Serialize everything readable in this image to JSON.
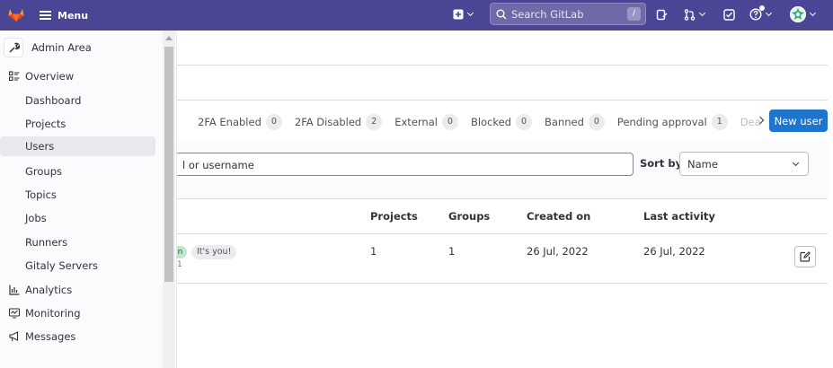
{
  "topbar": {
    "menu_label": "Menu",
    "search_placeholder": "Search GitLab",
    "search_shortcut": "/",
    "colors": {
      "bg": "#4a4594",
      "logo": "#e24329"
    },
    "icons": [
      "gitlab-logo",
      "plus-square-icon",
      "search-icon",
      "issues-icon",
      "merge-request-icon",
      "todo-check-icon",
      "help-icon",
      "avatar"
    ]
  },
  "sidebar": {
    "header": "Admin Area",
    "items": [
      {
        "label": "Overview",
        "level": "top",
        "icon": "overview-icon"
      },
      {
        "label": "Dashboard",
        "level": "sub"
      },
      {
        "label": "Projects",
        "level": "sub"
      },
      {
        "label": "Users",
        "level": "sub",
        "active": true
      },
      {
        "label": "Groups",
        "level": "sub"
      },
      {
        "label": "Topics",
        "level": "sub"
      },
      {
        "label": "Jobs",
        "level": "sub"
      },
      {
        "label": "Runners",
        "level": "sub"
      },
      {
        "label": "Gitaly Servers",
        "level": "sub"
      },
      {
        "label": "Analytics",
        "level": "top",
        "icon": "analytics-icon"
      },
      {
        "label": "Monitoring",
        "level": "top",
        "icon": "monitoring-icon"
      },
      {
        "label": "Messages",
        "level": "top",
        "icon": "messages-icon"
      }
    ]
  },
  "tabs": [
    {
      "label": "2FA Enabled",
      "count": "0"
    },
    {
      "label": "2FA Disabled",
      "count": "2"
    },
    {
      "label": "External",
      "count": "0"
    },
    {
      "label": "Blocked",
      "count": "0"
    },
    {
      "label": "Banned",
      "count": "0"
    },
    {
      "label": "Pending approval",
      "count": "1"
    },
    {
      "label": "Dea",
      "count": ""
    }
  ],
  "new_user_label": "New user",
  "filter": {
    "input_text": "l or username",
    "sort_label": "Sort by",
    "sort_value": "Name"
  },
  "table": {
    "headers": {
      "projects": "Projects",
      "groups": "Groups",
      "created": "Created on",
      "activity": "Last activity"
    },
    "row": {
      "badge": "n",
      "you_badge": "It's you!",
      "sub": "1",
      "projects": "1",
      "groups": "1",
      "created": "26 Jul, 2022",
      "activity": "26 Jul, 2022"
    }
  }
}
